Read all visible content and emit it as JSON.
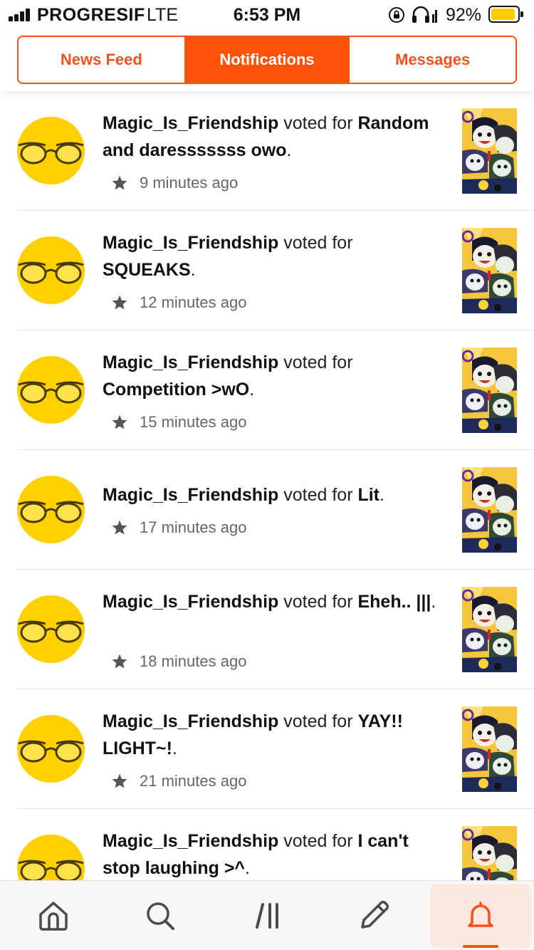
{
  "status_bar": {
    "carrier": "PROGRESIF",
    "network": "LTE",
    "time": "6:53 PM",
    "battery_percent": "92%",
    "battery_level": 0.92,
    "battery_color": "#ffcc00"
  },
  "tabs": [
    {
      "label": "News Feed",
      "active": false
    },
    {
      "label": "Notifications",
      "active": true
    },
    {
      "label": "Messages",
      "active": false
    }
  ],
  "notifications": [
    {
      "user": "Magic_Is_Friendship",
      "action": " voted for ",
      "story": "Random and daresssssss owo",
      "end": ".",
      "time": "9 minutes ago"
    },
    {
      "user": "Magic_Is_Friendship",
      "action": " voted for ",
      "story": "SQUEAKS",
      "end": ".",
      "time": "12 minutes ago"
    },
    {
      "user": "Magic_Is_Friendship",
      "action": " voted for ",
      "story": "Competition >wO",
      "end": ".",
      "time": "15 minutes ago"
    },
    {
      "user": "Magic_Is_Friendship",
      "action": " voted for ",
      "story": "Lit",
      "end": ".",
      "time": "17 minutes ago"
    },
    {
      "user": "Magic_Is_Friendship",
      "action": " voted for ",
      "story": "Eheh.. |||",
      "end": ".",
      "time": "18 minutes ago"
    },
    {
      "user": "Magic_Is_Friendship",
      "action": " voted for ",
      "story": "YAY!! LIGHT~!",
      "end": ".",
      "time": "21 minutes ago"
    },
    {
      "user": "Magic_Is_Friendship",
      "action": " voted for ",
      "story": "I can't stop laughing >^",
      "end": ".",
      "time": ""
    }
  ],
  "bottom_nav": [
    {
      "name": "home-icon",
      "active": false
    },
    {
      "name": "search-icon",
      "active": false
    },
    {
      "name": "library-icon",
      "active": false
    },
    {
      "name": "write-icon",
      "active": false
    },
    {
      "name": "notifications-bell-icon",
      "active": true
    }
  ],
  "colors": {
    "accent": "#f4511e",
    "active_tab": "#ff5309",
    "avatar_bg": "#ffd000"
  }
}
